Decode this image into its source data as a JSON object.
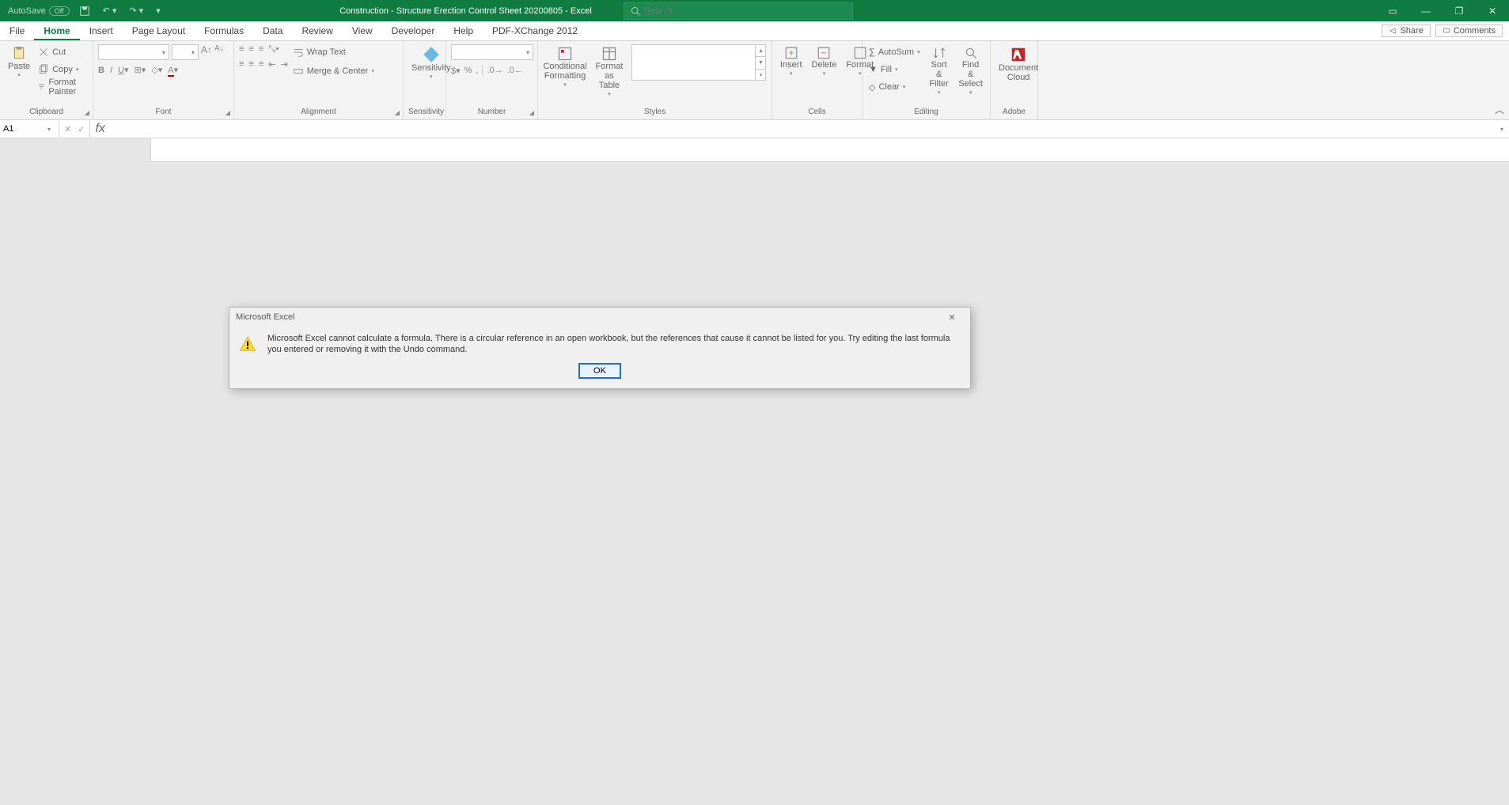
{
  "titlebar": {
    "autosave_label": "AutoSave",
    "autosave_state": "Off",
    "doc_title": "Construction - Structure Erection Control Sheet 20200805  -  Excel",
    "search_placeholder": "Search"
  },
  "tabs": {
    "items": [
      "File",
      "Home",
      "Insert",
      "Page Layout",
      "Formulas",
      "Data",
      "Review",
      "View",
      "Developer",
      "Help",
      "PDF-XChange 2012"
    ],
    "active_index": 1,
    "share": "Share",
    "comments": "Comments"
  },
  "ribbon": {
    "clipboard": {
      "label": "Clipboard",
      "paste": "Paste",
      "cut": "Cut",
      "copy": "Copy",
      "format_painter": "Format Painter"
    },
    "font": {
      "label": "Font",
      "name_value": "",
      "size_value": ""
    },
    "alignment": {
      "label": "Alignment",
      "wrap": "Wrap Text",
      "merge": "Merge & Center"
    },
    "sensitivity": {
      "label": "Sensitivity",
      "btn": "Sensitivity"
    },
    "number": {
      "label": "Number",
      "format_value": ""
    },
    "styles": {
      "label": "Styles",
      "cond": "Conditional Formatting",
      "table": "Format as Table"
    },
    "cells": {
      "label": "Cells",
      "insert": "Insert",
      "delete": "Delete",
      "format": "Format"
    },
    "editing": {
      "label": "Editing",
      "autosum": "AutoSum",
      "fill": "Fill",
      "clear": "Clear",
      "sort": "Sort & Filter",
      "find": "Find & Select"
    },
    "adobe": {
      "label": "Adobe",
      "btn": "Document Cloud"
    }
  },
  "formula_bar": {
    "namebox": "A1"
  },
  "dialog": {
    "title": "Microsoft Excel",
    "message": "Microsoft Excel cannot calculate a formula. There is a circular reference in an open workbook, but the references that cause it cannot be listed for you. Try editing the last formula you entered or removing it with the Undo command.",
    "ok": "OK"
  }
}
